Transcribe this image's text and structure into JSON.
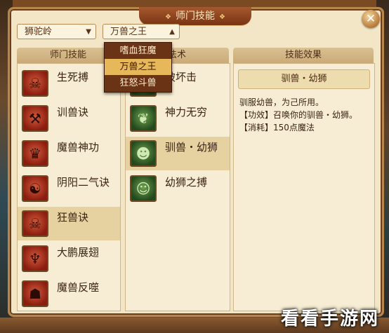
{
  "window": {
    "title": "师门技能",
    "close_symbol": "✕"
  },
  "dropdowns": {
    "sect": {
      "value": "狮驼岭",
      "arrow": "▼"
    },
    "skill": {
      "value": "万兽之王",
      "arrow": "▲"
    }
  },
  "menu_options": [
    "嗜血狂魔",
    "万兽之王",
    "狂怒斗兽"
  ],
  "menu_selected_index": 1,
  "columns": {
    "sect_skills": "师门技能",
    "spells": "法术",
    "effect": "技能效果"
  },
  "sect_skills": [
    {
      "label": "生死搏",
      "icon": "skull-claw-icon",
      "glyph": "☠"
    },
    {
      "label": "训兽诀",
      "icon": "wrench-tool-icon",
      "glyph": "⚒"
    },
    {
      "label": "魔兽神功",
      "icon": "demon-face-icon",
      "glyph": "♛"
    },
    {
      "label": "阴阳二气诀",
      "icon": "yinyang-flame-icon",
      "glyph": "☯"
    },
    {
      "label": "狂兽诀",
      "icon": "beast-skull-icon",
      "glyph": "☠",
      "selected": true
    },
    {
      "label": "大鹏展翅",
      "icon": "wings-icon",
      "glyph": "♆"
    },
    {
      "label": "魔兽反噬",
      "icon": "fanged-beast-icon",
      "glyph": "☗"
    }
  ],
  "spells": [
    {
      "label": "破坏击",
      "icon": "shatter-icon",
      "glyph": "✦"
    },
    {
      "label": "神力无穷",
      "icon": "cactus-power-icon",
      "glyph": "❦"
    },
    {
      "label": "驯兽・幼狮",
      "icon": "lion-cub-icon",
      "glyph": "☻",
      "selected": true
    },
    {
      "label": "幼狮之搏",
      "icon": "lion-roar-icon",
      "glyph": "☺"
    }
  ],
  "effect": {
    "name": "驯兽・幼狮",
    "desc": "驯服幼兽，为己所用。",
    "effect_line": "【功效】召唤你的驯兽・幼狮。",
    "cost_line": "【消耗】150点魔法"
  },
  "watermark": "看看手游网"
}
